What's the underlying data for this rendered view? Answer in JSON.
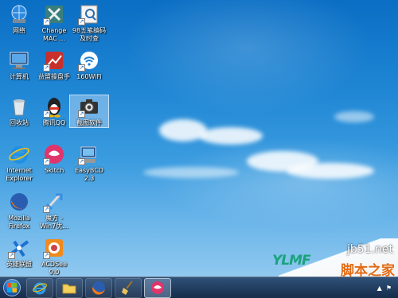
{
  "desktop": {
    "icons": [
      {
        "id": "network",
        "label": "网络",
        "icon": "network-icon"
      },
      {
        "id": "change-mac",
        "label": "Change\nMAC ...",
        "icon": "change-mac-icon"
      },
      {
        "id": "wubi",
        "label": "98五笔编码\n及时查",
        "icon": "wubi-lookup-icon"
      },
      {
        "id": "computer",
        "label": "计算机",
        "icon": "computer-icon"
      },
      {
        "id": "ent-disk",
        "label": "益盟操盘手",
        "icon": "trading-icon"
      },
      {
        "id": "wifi160",
        "label": "160WiFi",
        "icon": "wifi-icon"
      },
      {
        "id": "recycle",
        "label": "回收站",
        "icon": "recycle-bin-icon"
      },
      {
        "id": "qq",
        "label": "腾讯QQ",
        "icon": "qq-penguin-icon"
      },
      {
        "id": "screenshot",
        "label": "截图软件",
        "icon": "camera-icon"
      },
      {
        "id": "ie",
        "label": "Internet\nExplorer",
        "icon": "ie-icon"
      },
      {
        "id": "skitch",
        "label": "Skitch",
        "icon": "skitch-icon"
      },
      {
        "id": "easybcd",
        "label": "EasyBCD\n2.3",
        "icon": "easybcd-icon"
      },
      {
        "id": "firefox",
        "label": "Mozilla\nFirefox",
        "icon": "firefox-icon"
      },
      {
        "id": "win7",
        "label": "魔方 -\nWin7优...",
        "icon": "win7-optimizer-icon"
      },
      {
        "id": "game",
        "label": "英雄联盟",
        "icon": "game-icon"
      },
      {
        "id": "acdsee",
        "label": "ACDSee\n9.0",
        "icon": "acdsee-icon"
      }
    ]
  },
  "watermark": {
    "site": "jb51.net",
    "logo": "脚本之家"
  },
  "brand_logo": "YLMF",
  "taskbar": {
    "items": [
      {
        "icon": "ie-icon"
      },
      {
        "icon": "explorer-folder-icon"
      },
      {
        "icon": "firefox-icon"
      },
      {
        "icon": "broom-icon"
      },
      {
        "icon": "skitch-icon"
      }
    ],
    "tray_flag_icon": "action-center-icon"
  },
  "colors": {
    "sky": "#1f86d4",
    "accent": "#e36b14"
  }
}
